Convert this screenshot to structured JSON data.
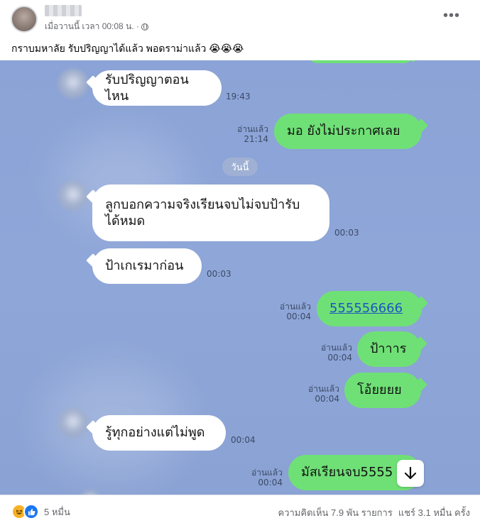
{
  "post": {
    "meta_time": "เมื่อวานนี้ เวลา 00:08 น. ·",
    "more_icon": "more-dots-icon",
    "caption": "กราบมหาลัย รับปริญญาได้แล้ว พอดราม่าแล้ว 😭😭😭"
  },
  "chat": {
    "background": "#8ba3d6",
    "day_divider": "วันนี้",
    "messages": [
      {
        "side": "in",
        "text": "รับปริญญาตอนไหน",
        "time": "19:43"
      },
      {
        "side": "out",
        "text": "มอ ยังไม่ประกาศเลย",
        "read": "อ่านแล้ว",
        "time": "21:14"
      },
      {
        "side": "in",
        "text": "ลูกบอกความจริงเรียนจบไม่จบป้ารับ",
        "text2": "ได้หมด",
        "time": "00:03"
      },
      {
        "side": "in",
        "text": "ป้าเกเรมาก่อน",
        "time": "00:03"
      },
      {
        "side": "out",
        "text": "555556666",
        "read": "อ่านแล้ว",
        "time": "00:04"
      },
      {
        "side": "out",
        "text": "ป้าาาร",
        "read": "อ่านแล้ว",
        "time": "00:04"
      },
      {
        "side": "out",
        "text": "โอ้ยยยย",
        "read": "อ่านแล้ว",
        "time": "00:04"
      },
      {
        "side": "in",
        "text": "รู้ทุกอย่างแต่ไม่พูด",
        "time": "00:04"
      },
      {
        "side": "out",
        "text": "มัสเรียนจบ5555",
        "read": "อ่านแล้ว",
        "time": "00:04"
      }
    ]
  },
  "footer": {
    "reaction_count": "5 หมื่น",
    "comments": "ความคิดเห็น 7.9 พัน รายการ",
    "shares": "แชร์ 3.1 หมื่น ครั้ง"
  }
}
